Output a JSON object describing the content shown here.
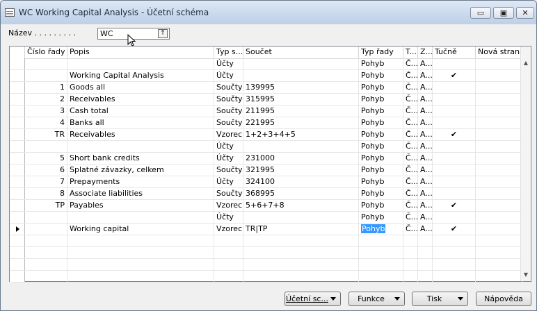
{
  "window": {
    "title": "WC Working Capital Analysis - Účetní schéma",
    "controls": {
      "minimize": "▭",
      "maximize": "▣",
      "close": "✕"
    }
  },
  "name_field": {
    "label": "Název  .  .  .  .  .  .  .  .  .",
    "value": "WC",
    "lookup_icon": "↑"
  },
  "table": {
    "headers": [
      "Číslo řady",
      "Popis",
      "Typ s...",
      "Součet",
      "Typ řady",
      "T...",
      "Z...",
      "Tučně",
      "Nová strana"
    ],
    "rows": [
      {
        "cislo": "",
        "popis": "",
        "typ": "Účty",
        "soucet": "",
        "typ_rady": "Pohyb",
        "t": "Č...",
        "z": "A...",
        "tucne": ""
      },
      {
        "cislo": "",
        "popis": "Working Capital Analysis",
        "typ": "Účty",
        "soucet": "",
        "typ_rady": "Pohyb",
        "t": "Č...",
        "z": "A...",
        "tucne": "✔"
      },
      {
        "cislo": "1",
        "popis": "Goods all",
        "typ": "Součty",
        "soucet": "139995",
        "typ_rady": "Pohyb",
        "t": "Č...",
        "z": "A...",
        "tucne": ""
      },
      {
        "cislo": "2",
        "popis": "Receivables",
        "typ": "Součty",
        "soucet": "315995",
        "typ_rady": "Pohyb",
        "t": "Č...",
        "z": "A...",
        "tucne": ""
      },
      {
        "cislo": "3",
        "popis": "Cash total",
        "typ": "Součty",
        "soucet": "211995",
        "typ_rady": "Pohyb",
        "t": "Č...",
        "z": "A...",
        "tucne": ""
      },
      {
        "cislo": "4",
        "popis": "Banks all",
        "typ": "Součty",
        "soucet": "221995",
        "typ_rady": "Pohyb",
        "t": "Č...",
        "z": "A...",
        "tucne": ""
      },
      {
        "cislo": "TR",
        "popis": " Receivables",
        "typ": "Vzorec",
        "soucet": "1+2+3+4+5",
        "typ_rady": "Pohyb",
        "t": "Č...",
        "z": "A...",
        "tucne": "✔"
      },
      {
        "cislo": "",
        "popis": "",
        "typ": "Účty",
        "soucet": "",
        "typ_rady": "Pohyb",
        "t": "Č...",
        "z": "A...",
        "tucne": ""
      },
      {
        "cislo": "5",
        "popis": "Short bank credits",
        "typ": "Účty",
        "soucet": "231000",
        "typ_rady": "Pohyb",
        "t": "Č...",
        "z": "A...",
        "tucne": ""
      },
      {
        "cislo": "6",
        "popis": "Splatné závazky, celkem",
        "typ": "Součty",
        "soucet": "321995",
        "typ_rady": "Pohyb",
        "t": "Č...",
        "z": "A...",
        "tucne": ""
      },
      {
        "cislo": "7",
        "popis": "Prepayments",
        "typ": "Účty",
        "soucet": "324100",
        "typ_rady": "Pohyb",
        "t": "Č...",
        "z": "A...",
        "tucne": ""
      },
      {
        "cislo": "8",
        "popis": "Associate liabilities",
        "typ": "Součty",
        "soucet": "368995",
        "typ_rady": "Pohyb",
        "t": "Č...",
        "z": "A...",
        "tucne": ""
      },
      {
        "cislo": "TP",
        "popis": "Payables",
        "typ": "Vzorec",
        "soucet": "5+6+7+8",
        "typ_rady": "Pohyb",
        "t": "Č...",
        "z": "A...",
        "tucne": "✔"
      },
      {
        "cislo": "",
        "popis": "",
        "typ": "Účty",
        "soucet": "",
        "typ_rady": "Pohyb",
        "t": "Č...",
        "z": "A...",
        "tucne": ""
      },
      {
        "cislo": "",
        "popis": "Working capital",
        "typ": "Vzorec",
        "soucet": "TR|TP",
        "typ_rady": "Pohyb",
        "t": "Č...",
        "z": "A...",
        "tucne": "✔",
        "current": true
      },
      {
        "cislo": "",
        "popis": "",
        "typ": "",
        "soucet": "",
        "typ_rady": "",
        "t": "",
        "z": "",
        "tucne": ""
      },
      {
        "cislo": "",
        "popis": "",
        "typ": "",
        "soucet": "",
        "typ_rady": "",
        "t": "",
        "z": "",
        "tucne": ""
      },
      {
        "cislo": "",
        "popis": "",
        "typ": "",
        "soucet": "",
        "typ_rady": "",
        "t": "",
        "z": "",
        "tucne": ""
      },
      {
        "cislo": "",
        "popis": "",
        "typ": "",
        "soucet": "",
        "typ_rady": "",
        "t": "",
        "z": "",
        "tucne": ""
      }
    ]
  },
  "scrollbar": {
    "up_icon": "▲",
    "down_icon": "▼"
  },
  "buttons": {
    "ucetni_schema": "Účetní sc...",
    "funkce": "Funkce",
    "tisk": "Tisk",
    "napoveda": "Nápověda"
  },
  "colors": {
    "selection": "#3399ff",
    "titlebar": "#c9d8ec"
  }
}
